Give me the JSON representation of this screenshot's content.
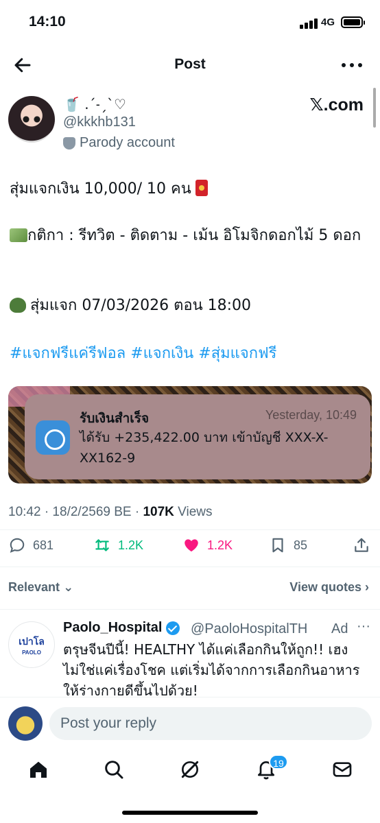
{
  "status": {
    "time": "14:10",
    "network": "4G"
  },
  "header": {
    "title": "Post"
  },
  "author": {
    "display_name": "🥤 .ˊ˗ˏˋ♡",
    "handle": "@kkkhb131",
    "label": "Parody account",
    "watermark": "𝕏.com"
  },
  "tweet": {
    "line1": "สุ่มแจกเงิน 10,000/ 10  คน",
    "line2": "กติกา : รีทวิต - ติดตาม - เม้น อิโมจิกดอกไม้ 5 ดอก",
    "line3": "สุ่มแจก 07/03/2026 ตอน 18:00",
    "hashtags": "#แจกฟรีแค่รีฟอล #แจกเงิน #สุ่มแจกฟรี"
  },
  "media": {
    "title": "รับเงินสำเร็จ",
    "time": "Yesterday, 10:49",
    "body": "ได้รับ +235,422.00 บาท เข้าบัญชี XXX-X-XX162-9"
  },
  "meta": {
    "timestamp": "10:42 · 18/2/2569 BE · ",
    "views_count": "107K",
    "views_label": " Views"
  },
  "actions": {
    "replies": "681",
    "reposts": "1.2K",
    "likes": "1.2K",
    "bookmarks": "85"
  },
  "sort": {
    "label": "Relevant",
    "quotes": "View quotes"
  },
  "ad": {
    "name": "Paolo_Hospital",
    "handle": "@PaoloHospitalTH",
    "tag": "Ad",
    "logo_top": "เปาโล",
    "logo_bottom": "PAOLO",
    "text": "ตรุษจีนปีนี้! HEALTHY ได้แค่เลือกกินให้ถูก!! เฮงไม่ใช่แค่เรื่องโชค แต่เริ่มได้จากการเลือกกินอาหารให้ร่างกายดีขึ้นไปด้วย!"
  },
  "reply": {
    "placeholder": "Post your reply"
  },
  "tabbar": {
    "notifications_badge": "19"
  },
  "colors": {
    "accent": "#1d9bf0",
    "like": "#f91880",
    "repost": "#00ba7c"
  },
  "icons": [
    "back-arrow-icon",
    "more-icon",
    "reply-icon",
    "repost-icon",
    "heart-icon",
    "bookmark-icon",
    "share-icon",
    "home-icon",
    "search-icon",
    "grok-icon",
    "bell-icon",
    "mail-icon"
  ]
}
